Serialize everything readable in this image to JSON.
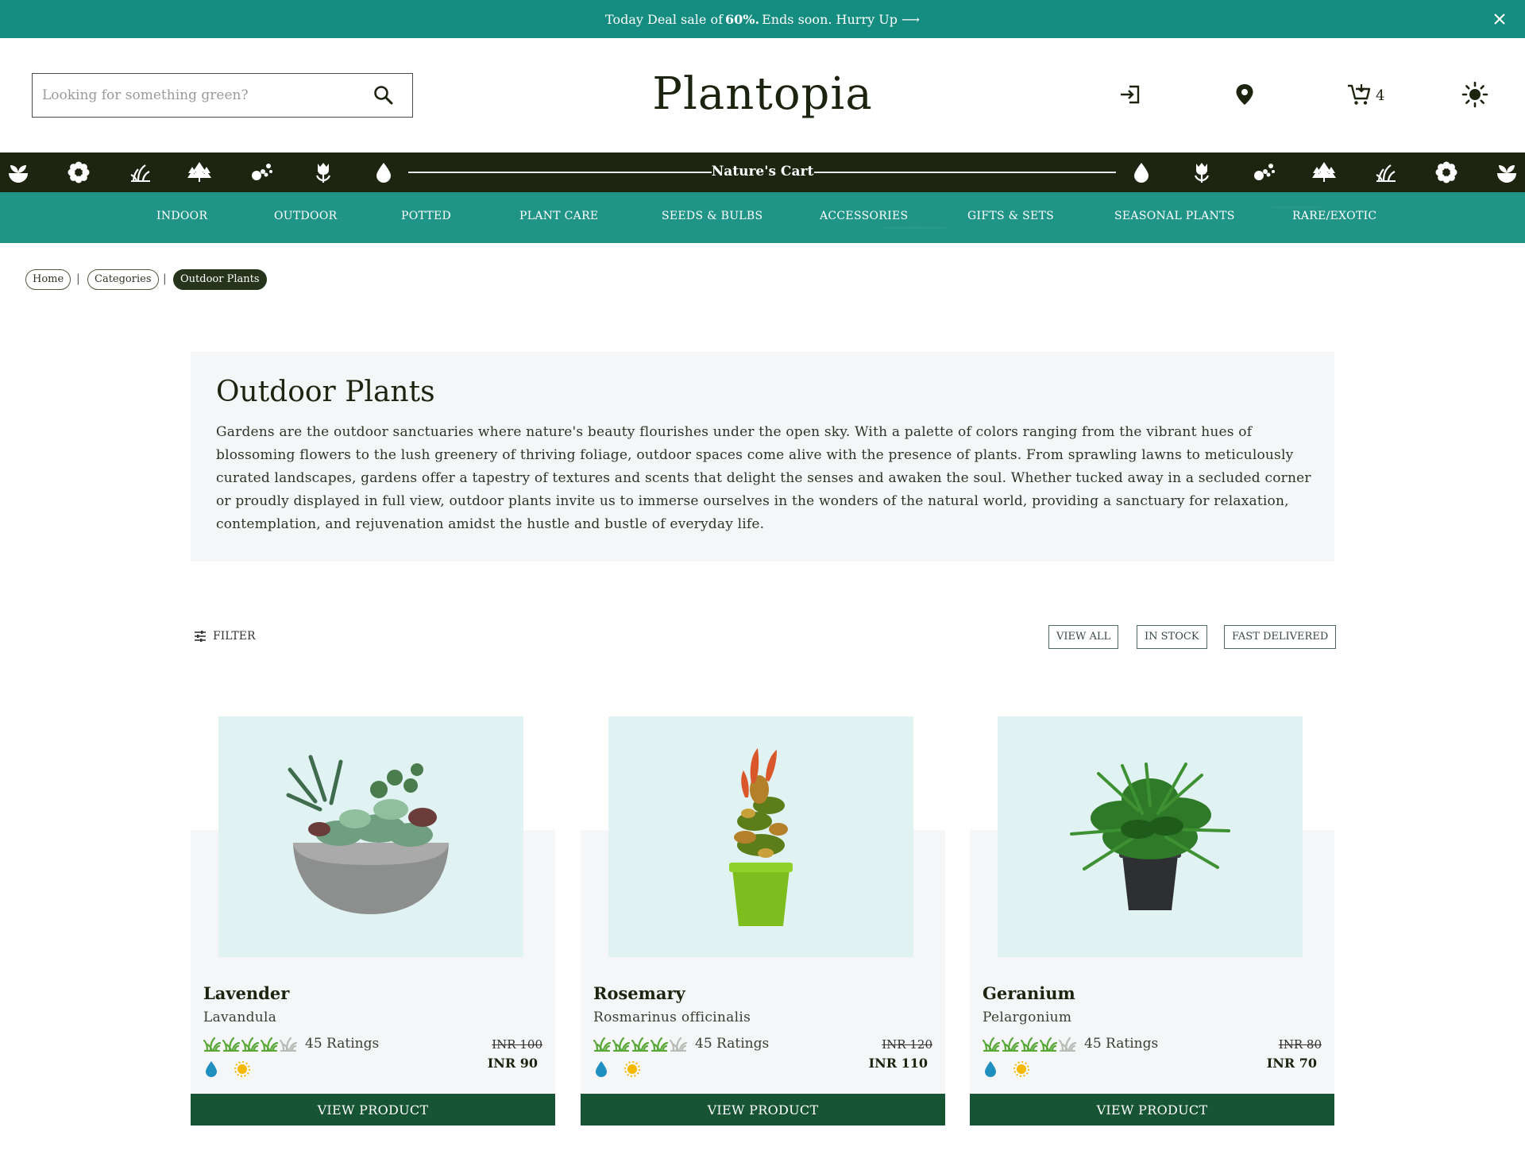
{
  "announcement": {
    "text_before": "Today Deal sale of",
    "highlight": "60%.",
    "text_after": "Ends soon. Hurry Up ⟶"
  },
  "header": {
    "search_placeholder": "Looking for something green?",
    "logo": "Plantopia",
    "cart_count": "4"
  },
  "strip": {
    "title": "Nature's Cart"
  },
  "nav": {
    "items": [
      "INDOOR",
      "OUTDOOR",
      "POTTED",
      "PLANT CARE",
      "SEEDS & BULBS",
      "ACCESSORIES",
      "GIFTS & SETS",
      "SEASONAL PLANTS",
      "RARE/EXOTIC"
    ]
  },
  "breadcrumb": {
    "items": [
      "Home",
      "Categories",
      "Outdoor Plants"
    ],
    "separator": "|"
  },
  "intro": {
    "title": "Outdoor Plants",
    "description": "Gardens are the outdoor sanctuaries where nature's beauty flourishes under the open sky. With a palette of colors ranging from the vibrant hues of blossoming flowers to the lush greenery of thriving foliage, outdoor spaces come alive with the presence of plants. From sprawling lawns to meticulously curated landscapes, gardens offer a tapestry of textures and scents that delight the senses and awaken the soul. Whether tucked away in a secluded corner or proudly displayed in full view, outdoor plants invite us to immerse ourselves in the wonders of the natural world, providing a sanctuary for relaxation, contemplation, and rejuvenation amidst the hustle and bustle of everyday life."
  },
  "filters": {
    "filter_label": "FILTER",
    "buttons": [
      "VIEW ALL",
      "IN STOCK",
      "FAST DELIVERED"
    ]
  },
  "products": [
    {
      "name": "Lavender",
      "scientific": "Lavandula",
      "rating": 4,
      "rating_text": "45 Ratings",
      "old_price": "INR 100",
      "price": "INR 90",
      "cta": "VIEW PRODUCT"
    },
    {
      "name": "Rosemary",
      "scientific": "Rosmarinus officinalis",
      "rating": 4,
      "rating_text": "45 Ratings",
      "old_price": "INR 120",
      "price": "INR 110",
      "cta": "VIEW PRODUCT"
    },
    {
      "name": "Geranium",
      "scientific": "Pelargonium",
      "rating": 4,
      "rating_text": "45 Ratings",
      "old_price": "INR 80",
      "price": "INR 70",
      "cta": "VIEW PRODUCT"
    }
  ],
  "colors": {
    "teal": "#148c80",
    "dark_olive": "#1d240f",
    "forest_button": "#175434",
    "card_bg": "#f4f6f7",
    "image_bg": "#e1f2f2"
  }
}
